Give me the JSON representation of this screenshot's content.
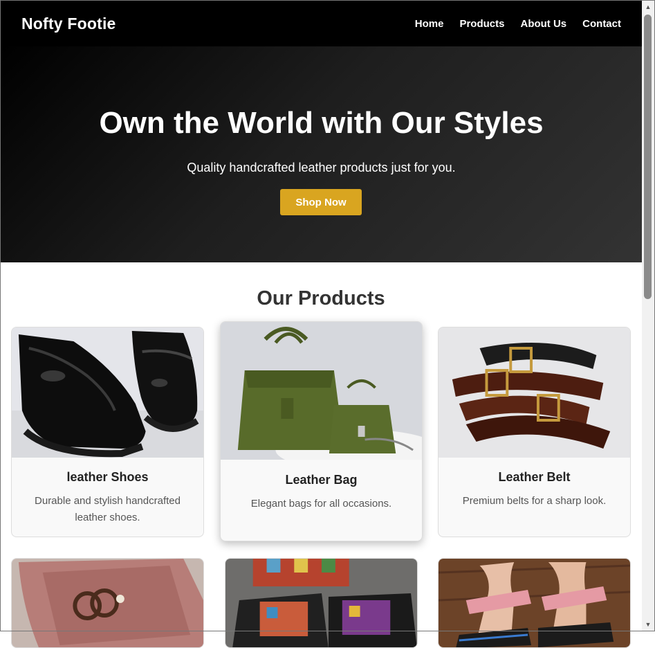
{
  "header": {
    "brand": "Nofty Footie",
    "nav": [
      "Home",
      "Products",
      "About Us",
      "Contact"
    ]
  },
  "hero": {
    "title": "Own the World with Our Styles",
    "subtitle": "Quality handcrafted leather products just for you.",
    "cta": "Shop Now"
  },
  "products_section": {
    "title": "Our Products",
    "items": [
      {
        "title": "leather Shoes",
        "desc": "Durable and stylish handcrafted leather shoes.",
        "image": "black-loafers-photo"
      },
      {
        "title": "Leather Bag",
        "desc": "Elegant bags for all occasions.",
        "image": "olive-handbags-photo"
      },
      {
        "title": "Leather Belt",
        "desc": "Premium belts for a sharp look.",
        "image": "leather-belts-photo"
      },
      {
        "image": "pink-slide-sandal-photo"
      },
      {
        "image": "patchwork-slides-photo"
      },
      {
        "image": "pink-strap-sandals-photo"
      }
    ]
  },
  "colors": {
    "nav_bg": "#000000",
    "accent": "#d9a520",
    "card_bg": "#f9f9f9"
  }
}
